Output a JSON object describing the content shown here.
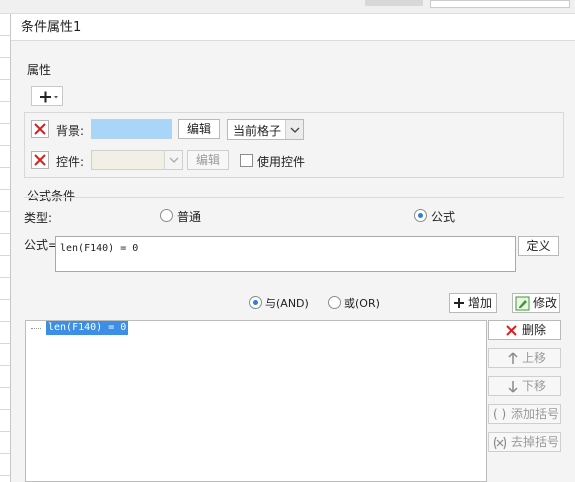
{
  "window": {
    "title": "条件属性1"
  },
  "properties": {
    "section_label": "属性",
    "add_icon": "plus-icon",
    "background_row": {
      "label": "背景:",
      "color_hex": "#a9d5f8",
      "edit_label": "编辑",
      "scope_value": "当前格子"
    },
    "control_row": {
      "label": "控件:",
      "edit_label": "编辑",
      "use_control_label": "使用控件",
      "use_control_checked": false
    }
  },
  "formula_condition": {
    "section_label": "公式条件",
    "type_label": "类型:",
    "type_options": [
      {
        "label": "普通",
        "selected": false
      },
      {
        "label": "公式",
        "selected": true
      }
    ],
    "formula_label": "公式=",
    "formula_value": "len(F140) = 0",
    "define_label": "定义",
    "logic_options": [
      {
        "label": "与(AND)",
        "selected": true
      },
      {
        "label": "或(OR)",
        "selected": false
      }
    ],
    "add_label": "增加",
    "modify_label": "修改",
    "conditions": [
      "len(F140) = 0"
    ],
    "side_buttons": {
      "delete": "删除",
      "move_up": "上移",
      "move_down": "下移",
      "add_paren": "添加括号",
      "remove_paren": "去掉括号"
    }
  }
}
